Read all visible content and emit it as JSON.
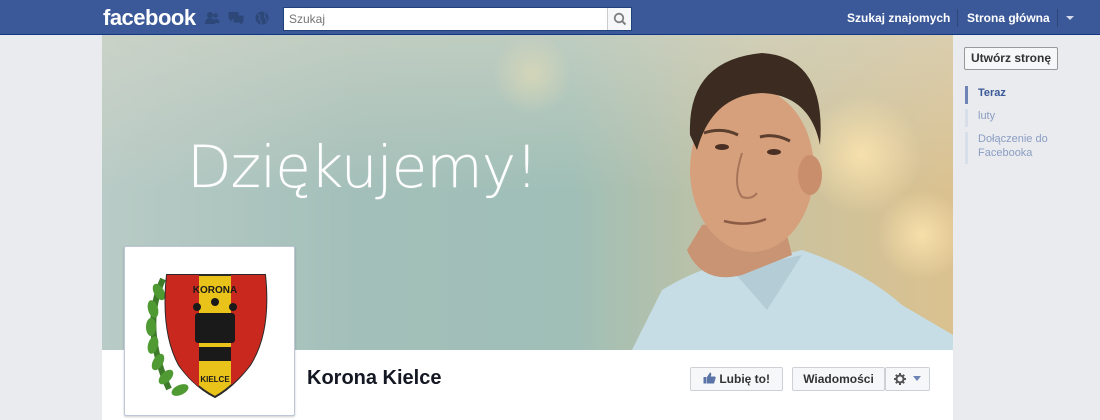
{
  "topbar": {
    "logo": "facebook",
    "search_placeholder": "Szukaj",
    "nav": {
      "find_friends": "Szukaj znajomych",
      "home": "Strona główna"
    }
  },
  "cover": {
    "title": "Dziękujemy!"
  },
  "page": {
    "name": "Korona Kielce",
    "logo_text_top": "KORONA",
    "logo_text_bottom": "KIELCE",
    "like_label": "Lubię to!",
    "messages_label": "Wiadomości"
  },
  "sidebar": {
    "create_page_label": "Utwórz stronę",
    "timeline": [
      {
        "label": "Teraz",
        "active": true
      },
      {
        "label": "luty",
        "active": false
      },
      {
        "label": "Dołączenie do Facebooka",
        "active": false
      }
    ]
  },
  "colors": {
    "brand_blue": "#3b5998",
    "topbar_border": "#133783"
  }
}
